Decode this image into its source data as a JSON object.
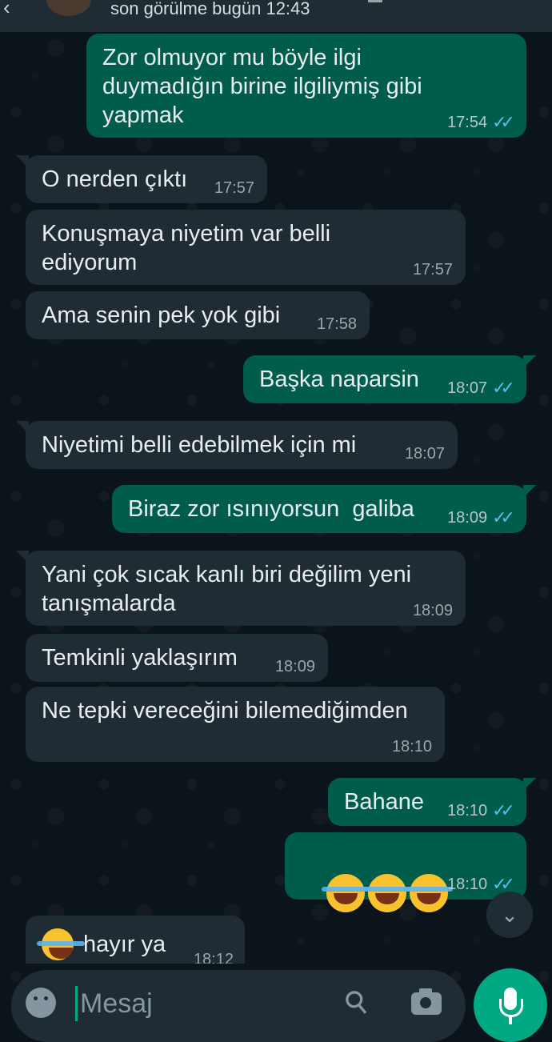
{
  "header": {
    "last_seen": "son görülme bugün 12:43"
  },
  "messages": [
    {
      "dir": "out",
      "text": "Zor olmuyor mu böyle ilgi\nduymadığın birine ilgiliymiş gibi\nyapmak",
      "time": "17:54",
      "read": true
    },
    {
      "dir": "in",
      "text": "O nerden çıktı",
      "time": "17:57"
    },
    {
      "dir": "in",
      "text": "Konuşmaya niyetim var belli\nediyorum",
      "time": "17:57"
    },
    {
      "dir": "in",
      "text": "Ama senin pek yok gibi",
      "time": "17:58"
    },
    {
      "dir": "out",
      "text": "Başka naparsin",
      "time": "18:07",
      "read": true
    },
    {
      "dir": "in",
      "text": "Niyetimi belli edebilmek için mi",
      "time": "18:07"
    },
    {
      "dir": "out",
      "text": "Biraz zor ısınıyorsun  galiba",
      "time": "18:09",
      "read": true
    },
    {
      "dir": "in",
      "text": "Yani çok sıcak kanlı biri değilim yeni\ntanışmalarda",
      "time": "18:09"
    },
    {
      "dir": "in",
      "text": "Temkinli yaklaşırım",
      "time": "18:09"
    },
    {
      "dir": "in",
      "text": "Ne tepki vereceğini bilemediğimden",
      "time": "18:10"
    },
    {
      "dir": "out",
      "text": "Bahane",
      "time": "18:10",
      "read": true
    },
    {
      "dir": "out",
      "emoji": "tears-of-joy-face x3",
      "time": "18:10",
      "read": true
    },
    {
      "dir": "in",
      "emoji": "grinning-sweat-face",
      "text": "hayır ya",
      "time": "18:12"
    }
  ],
  "ticks_symbol": "✓✓",
  "composer": {
    "placeholder": "Mesaj"
  },
  "icons": [
    "back-arrow-icon",
    "scroll-down-icon",
    "emoji-icon",
    "attach-icon",
    "camera-icon",
    "mic-icon"
  ],
  "colors": {
    "incoming_bubble": "#202c33",
    "outgoing_bubble": "#005c4b",
    "read_ticks": "#53bdeb",
    "accent": "#00a884"
  }
}
